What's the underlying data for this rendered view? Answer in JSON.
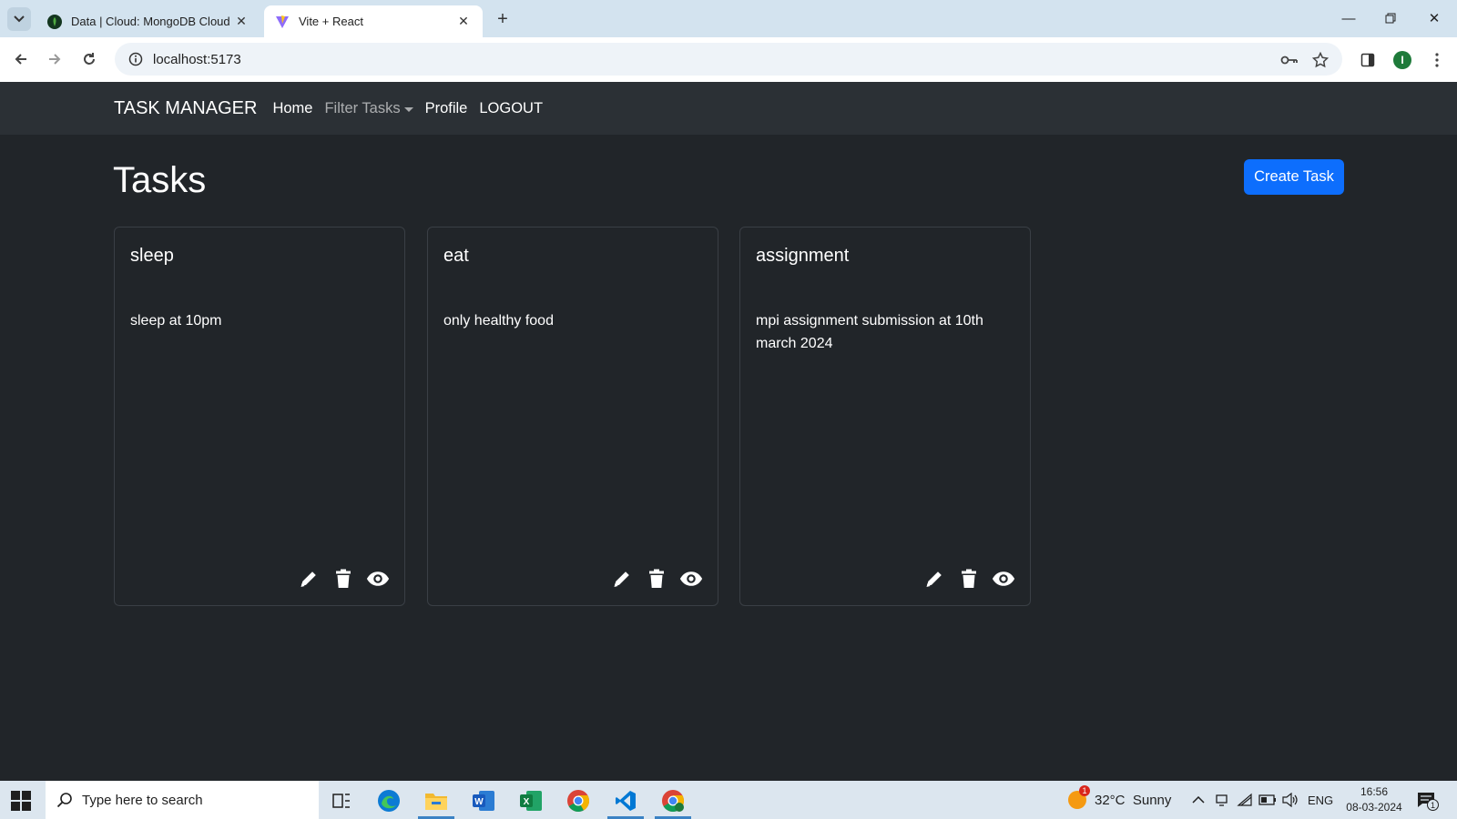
{
  "browser": {
    "tabs": [
      {
        "title": "Data | Cloud: MongoDB Cloud",
        "active": false
      },
      {
        "title": "Vite + React",
        "active": true
      }
    ],
    "url": "localhost:5173",
    "profile_initial": "I"
  },
  "navbar": {
    "brand": "TASK MANAGER",
    "links": [
      "Home",
      "Filter Tasks",
      "Profile",
      "LOGOUT"
    ]
  },
  "page": {
    "title": "Tasks",
    "create_label": "Create Task"
  },
  "tasks": [
    {
      "title": "sleep",
      "description": "sleep at 10pm"
    },
    {
      "title": "eat",
      "description": "only healthy food"
    },
    {
      "title": "assignment",
      "description": "mpi assignment submission at 10th march 2024"
    }
  ],
  "taskbar": {
    "search_placeholder": "Type here to search",
    "weather": "32°C  Sunny",
    "weather_badge": "1",
    "language": "ENG",
    "time": "16:56",
    "date": "08-03-2024",
    "notification_count": "1"
  },
  "colors": {
    "page_bg": "#212529",
    "navbar_bg": "#2b3035",
    "primary": "#0d6efd"
  }
}
